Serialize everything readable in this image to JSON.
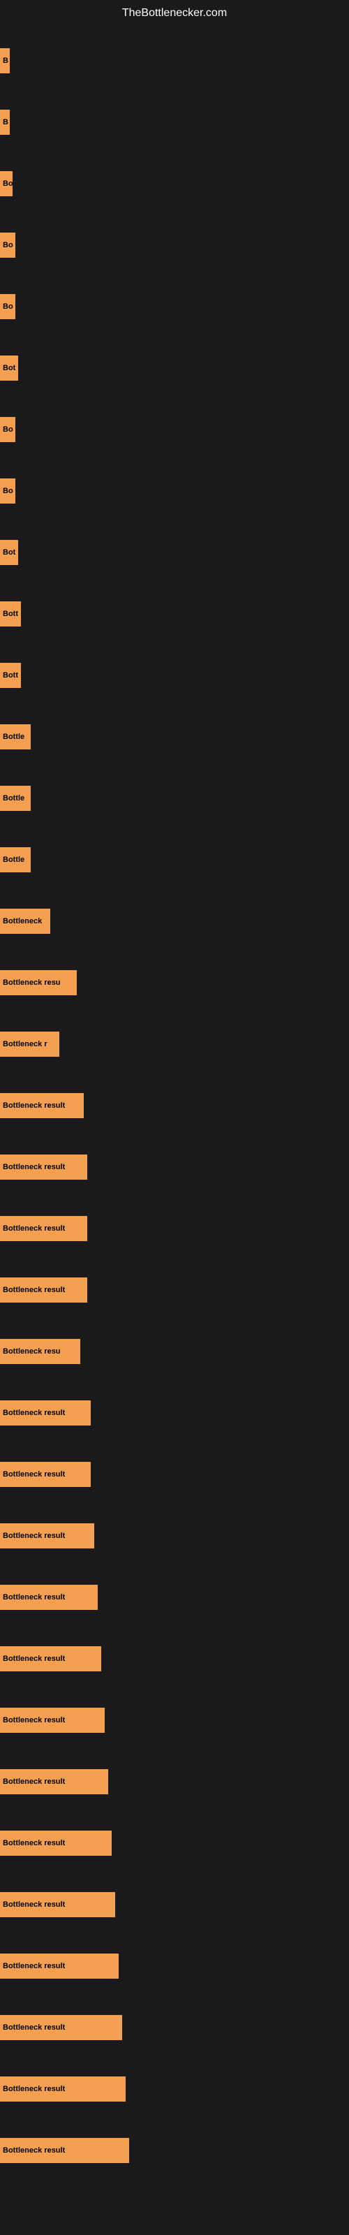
{
  "site": {
    "title": "TheBottlenecker.com"
  },
  "bars": [
    {
      "id": 1,
      "label": "B",
      "width": 14
    },
    {
      "id": 2,
      "label": "B",
      "width": 14
    },
    {
      "id": 3,
      "label": "Bo",
      "width": 18
    },
    {
      "id": 4,
      "label": "Bo",
      "width": 22
    },
    {
      "id": 5,
      "label": "Bo",
      "width": 22
    },
    {
      "id": 6,
      "label": "Bot",
      "width": 26
    },
    {
      "id": 7,
      "label": "Bo",
      "width": 22
    },
    {
      "id": 8,
      "label": "Bo",
      "width": 22
    },
    {
      "id": 9,
      "label": "Bot",
      "width": 26
    },
    {
      "id": 10,
      "label": "Bott",
      "width": 30
    },
    {
      "id": 11,
      "label": "Bott",
      "width": 30
    },
    {
      "id": 12,
      "label": "Bottle",
      "width": 44
    },
    {
      "id": 13,
      "label": "Bottle",
      "width": 44
    },
    {
      "id": 14,
      "label": "Bottle",
      "width": 44
    },
    {
      "id": 15,
      "label": "Bottleneck",
      "width": 72
    },
    {
      "id": 16,
      "label": "Bottleneck resu",
      "width": 110
    },
    {
      "id": 17,
      "label": "Bottleneck r",
      "width": 85
    },
    {
      "id": 18,
      "label": "Bottleneck result",
      "width": 120
    },
    {
      "id": 19,
      "label": "Bottleneck result",
      "width": 125
    },
    {
      "id": 20,
      "label": "Bottleneck result",
      "width": 125
    },
    {
      "id": 21,
      "label": "Bottleneck result",
      "width": 125
    },
    {
      "id": 22,
      "label": "Bottleneck resu",
      "width": 115
    },
    {
      "id": 23,
      "label": "Bottleneck result",
      "width": 130
    },
    {
      "id": 24,
      "label": "Bottleneck result",
      "width": 130
    },
    {
      "id": 25,
      "label": "Bottleneck result",
      "width": 135
    },
    {
      "id": 26,
      "label": "Bottleneck result",
      "width": 140
    },
    {
      "id": 27,
      "label": "Bottleneck result",
      "width": 145
    },
    {
      "id": 28,
      "label": "Bottleneck result",
      "width": 150
    },
    {
      "id": 29,
      "label": "Bottleneck result",
      "width": 155
    },
    {
      "id": 30,
      "label": "Bottleneck result",
      "width": 160
    },
    {
      "id": 31,
      "label": "Bottleneck result",
      "width": 165
    },
    {
      "id": 32,
      "label": "Bottleneck result",
      "width": 170
    },
    {
      "id": 33,
      "label": "Bottleneck result",
      "width": 175
    },
    {
      "id": 34,
      "label": "Bottleneck result",
      "width": 180
    },
    {
      "id": 35,
      "label": "Bottleneck result",
      "width": 185
    }
  ]
}
